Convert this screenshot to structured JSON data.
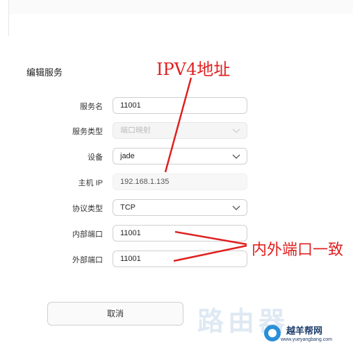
{
  "dialog": {
    "title": "编辑服务"
  },
  "form": {
    "service_name": {
      "label": "服务名",
      "value": "11001"
    },
    "service_type": {
      "label": "服务类型",
      "value": "端口映射"
    },
    "device": {
      "label": "设备",
      "value": "jade"
    },
    "host_ip": {
      "label": "主机 IP",
      "value": "192.168.1.135"
    },
    "protocol": {
      "label": "协议类型",
      "value": "TCP"
    },
    "internal_port": {
      "label": "内部端口",
      "value": "11001"
    },
    "external_port": {
      "label": "外部端口",
      "value": "11001"
    }
  },
  "buttons": {
    "cancel": "取消"
  },
  "annotations": {
    "ipv4": "IPV4地址",
    "ports": "内外端口一致",
    "color": "#e02020"
  },
  "watermark": {
    "text": "路由器",
    "brand": "越羊帮网",
    "url": "www.yueyangbang.com"
  }
}
